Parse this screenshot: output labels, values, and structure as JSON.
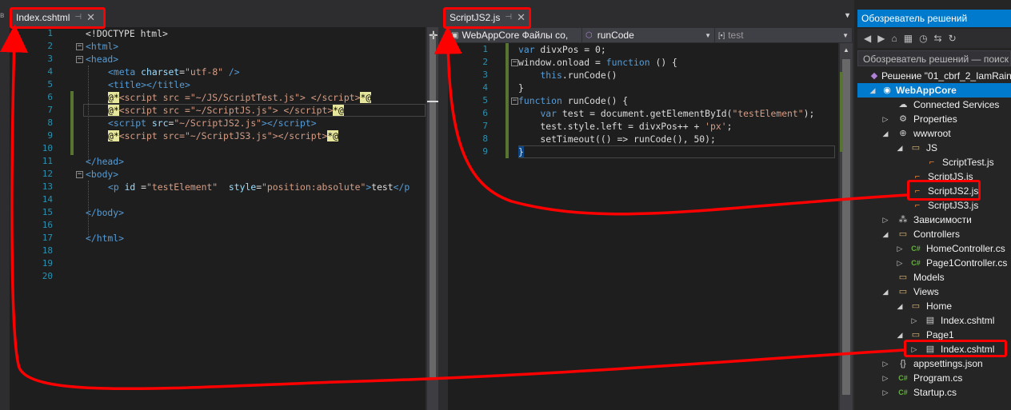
{
  "left_editor": {
    "tab_label": "Index.cshtml",
    "stub_char": "в",
    "line_numbers": [
      "1",
      "2",
      "3",
      "4",
      "5",
      "6",
      "7",
      "8",
      "9",
      "10",
      "11",
      "12",
      "13",
      "14",
      "15",
      "16",
      "17",
      "18",
      "19",
      "20"
    ]
  },
  "right_editor": {
    "tab_label": "ScriptJS2.js",
    "nav_project": "WebAppCore Файлы со,",
    "nav_method": "runCode",
    "nav_member": "test",
    "line_numbers": [
      "1",
      "2",
      "3",
      "4",
      "5",
      "6",
      "7",
      "8",
      "9"
    ]
  },
  "solution_explorer": {
    "title": "Обозреватель решений",
    "search_placeholder": "Обозреватель решений — поиск",
    "items": [
      {
        "label": "Решение \"01_cbrf_2_IamRain_"
      },
      {
        "label": "WebAppCore"
      },
      {
        "label": "Connected Services"
      },
      {
        "label": "Properties"
      },
      {
        "label": "wwwroot"
      },
      {
        "label": "JS"
      },
      {
        "label": "ScriptTest.js"
      },
      {
        "label": "ScriptJS.js"
      },
      {
        "label": "ScriptJS2.js"
      },
      {
        "label": "ScriptJS3.js"
      },
      {
        "label": "Зависимости"
      },
      {
        "label": "Controllers"
      },
      {
        "label": "HomeController.cs"
      },
      {
        "label": "Page1Controller.cs"
      },
      {
        "label": "Models"
      },
      {
        "label": "Views"
      },
      {
        "label": "Home"
      },
      {
        "label": "Index.cshtml"
      },
      {
        "label": "Page1"
      },
      {
        "label": "Index.cshtml"
      },
      {
        "label": "appsettings.json"
      },
      {
        "label": "Program.cs"
      },
      {
        "label": "Startup.cs"
      }
    ]
  },
  "colors": {
    "accent": "#007acc",
    "annotation": "#ff0000",
    "editor_bg": "#1e1e1e"
  }
}
